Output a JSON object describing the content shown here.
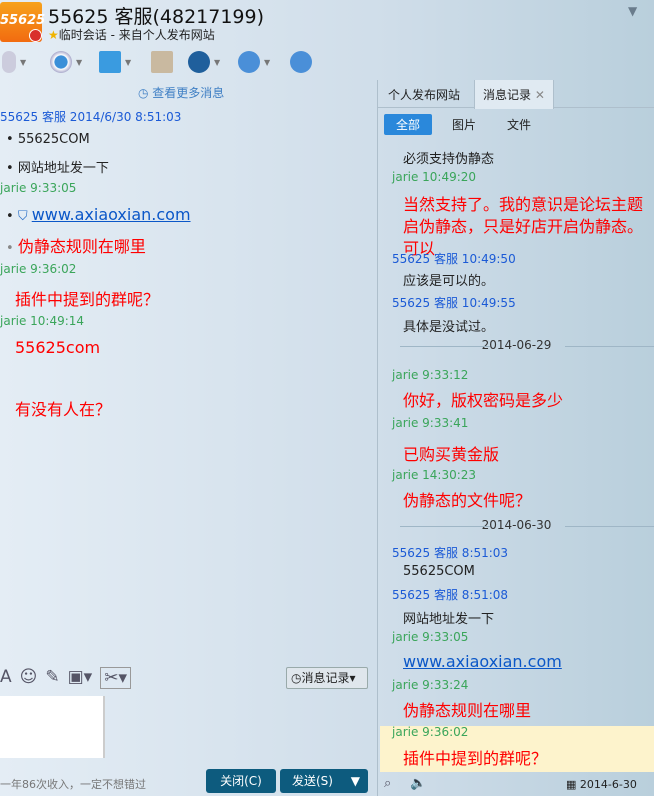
{
  "window": {
    "logo": "55625",
    "title": "55625 客服(48217199)",
    "subtitle": "临时会话 - 来自个人发布网站"
  },
  "left": {
    "more": "查看更多消息",
    "messages": [
      {
        "meta": "55625 客服 2014/6/30 8:51:03",
        "kind": "blue"
      },
      {
        "text": "55625COM"
      },
      {
        "text": "网站地址发一下"
      },
      {
        "meta": "jarie 9:33:05",
        "kind": "green"
      },
      {
        "link": "www.axiaoxian.com"
      },
      {
        "text": "伪静态规则在哪里",
        "red": true
      },
      {
        "meta": "jarie 9:36:02",
        "kind": "green"
      },
      {
        "text": "插件中提到的群呢？",
        "red": true
      },
      {
        "meta": "jarie 10:49:14",
        "kind": "green"
      },
      {
        "text": "55625com",
        "red": true
      },
      {
        "text": "有没有人在？",
        "red": true
      }
    ]
  },
  "input": {
    "history_button": "消息记录",
    "ad": "一年86次收入，一定不想错过",
    "close": "关闭(C)",
    "send": "发送(S)"
  },
  "right": {
    "tabs": [
      "个人发布网站",
      "消息记录"
    ],
    "filters": [
      "全部",
      "图片",
      "文件"
    ],
    "records": [
      {
        "text": "必须支持伪静态"
      },
      {
        "meta": "jarie 10:49:20",
        "kind": "green"
      },
      {
        "text": "当然支持了。我的意识是论坛主题启伪静态，只是好店开启伪静态。可以",
        "red": true
      },
      {
        "meta": "55625 客服 10:49:50",
        "kind": "blue"
      },
      {
        "text": "应该是可以的。"
      },
      {
        "meta": "55625 客服 10:49:55",
        "kind": "blue"
      },
      {
        "text": "具体是没试过。"
      },
      {
        "date": "2014-06-29"
      },
      {
        "meta": "jarie 9:33:12",
        "kind": "green"
      },
      {
        "text": "你好，版权密码是多少",
        "red": true
      },
      {
        "meta": "jarie 9:33:41",
        "kind": "green"
      },
      {
        "text": "已购买黄金版",
        "red": true
      },
      {
        "meta": "jarie 14:30:23",
        "kind": "green"
      },
      {
        "text": "伪静态的文件呢？",
        "red": true
      },
      {
        "date": "2014-06-30"
      },
      {
        "meta": "55625 客服 8:51:03",
        "kind": "blue"
      },
      {
        "text": "55625COM"
      },
      {
        "meta": "55625 客服 8:51:08",
        "kind": "blue"
      },
      {
        "text": "网站地址发一下"
      },
      {
        "meta": "jarie 9:33:05",
        "kind": "green"
      },
      {
        "link": "www.axiaoxian.com"
      },
      {
        "meta": "jarie 9:33:24",
        "kind": "green"
      },
      {
        "text": "伪静态规则在哪里",
        "red": true
      },
      {
        "meta": "jarie 9:36:02",
        "kind": "green"
      },
      {
        "text": "插件中提到的群呢？",
        "red": true
      }
    ],
    "date_picker": "2014-6-30"
  }
}
